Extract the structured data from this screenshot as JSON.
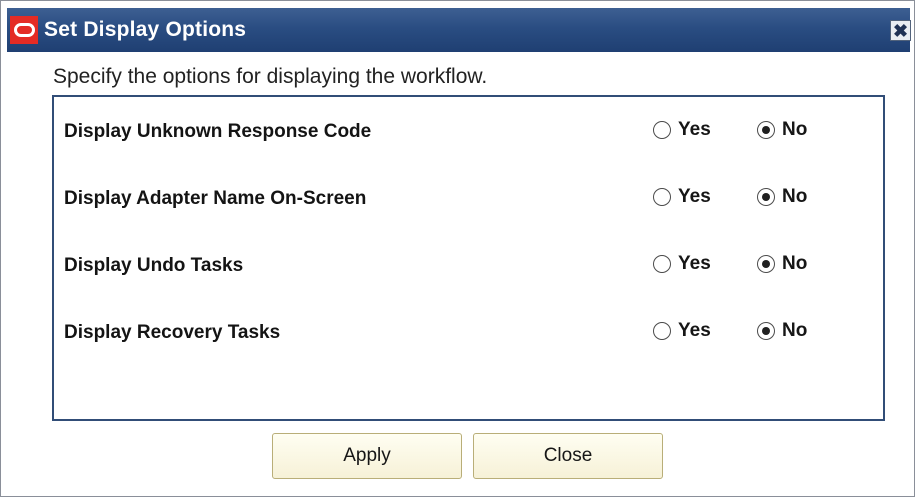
{
  "dialog": {
    "title": "Set Display Options",
    "instruction": "Specify the options for displaying the workflow.",
    "close_glyph": "✖",
    "options": [
      {
        "label": "Display Unknown Response Code",
        "yes_label": "Yes",
        "no_label": "No",
        "selected": "No"
      },
      {
        "label": "Display Adapter Name On-Screen",
        "yes_label": "Yes",
        "no_label": "No",
        "selected": "No"
      },
      {
        "label": "Display Undo Tasks",
        "yes_label": "Yes",
        "no_label": "No",
        "selected": "No"
      },
      {
        "label": "Display Recovery Tasks",
        "yes_label": "Yes",
        "no_label": "No",
        "selected": "No"
      }
    ],
    "buttons": {
      "apply": "Apply",
      "close": "Close"
    }
  },
  "colors": {
    "titlebar": "#2a4d82",
    "panel_border": "#314d77",
    "logo": "#e42b24",
    "button_bg": "#f6f1d7",
    "button_border": "#b9ae78"
  },
  "icons": {
    "logo": "oracle-logo-icon",
    "close": "close-icon",
    "radio": "radio-icon"
  }
}
